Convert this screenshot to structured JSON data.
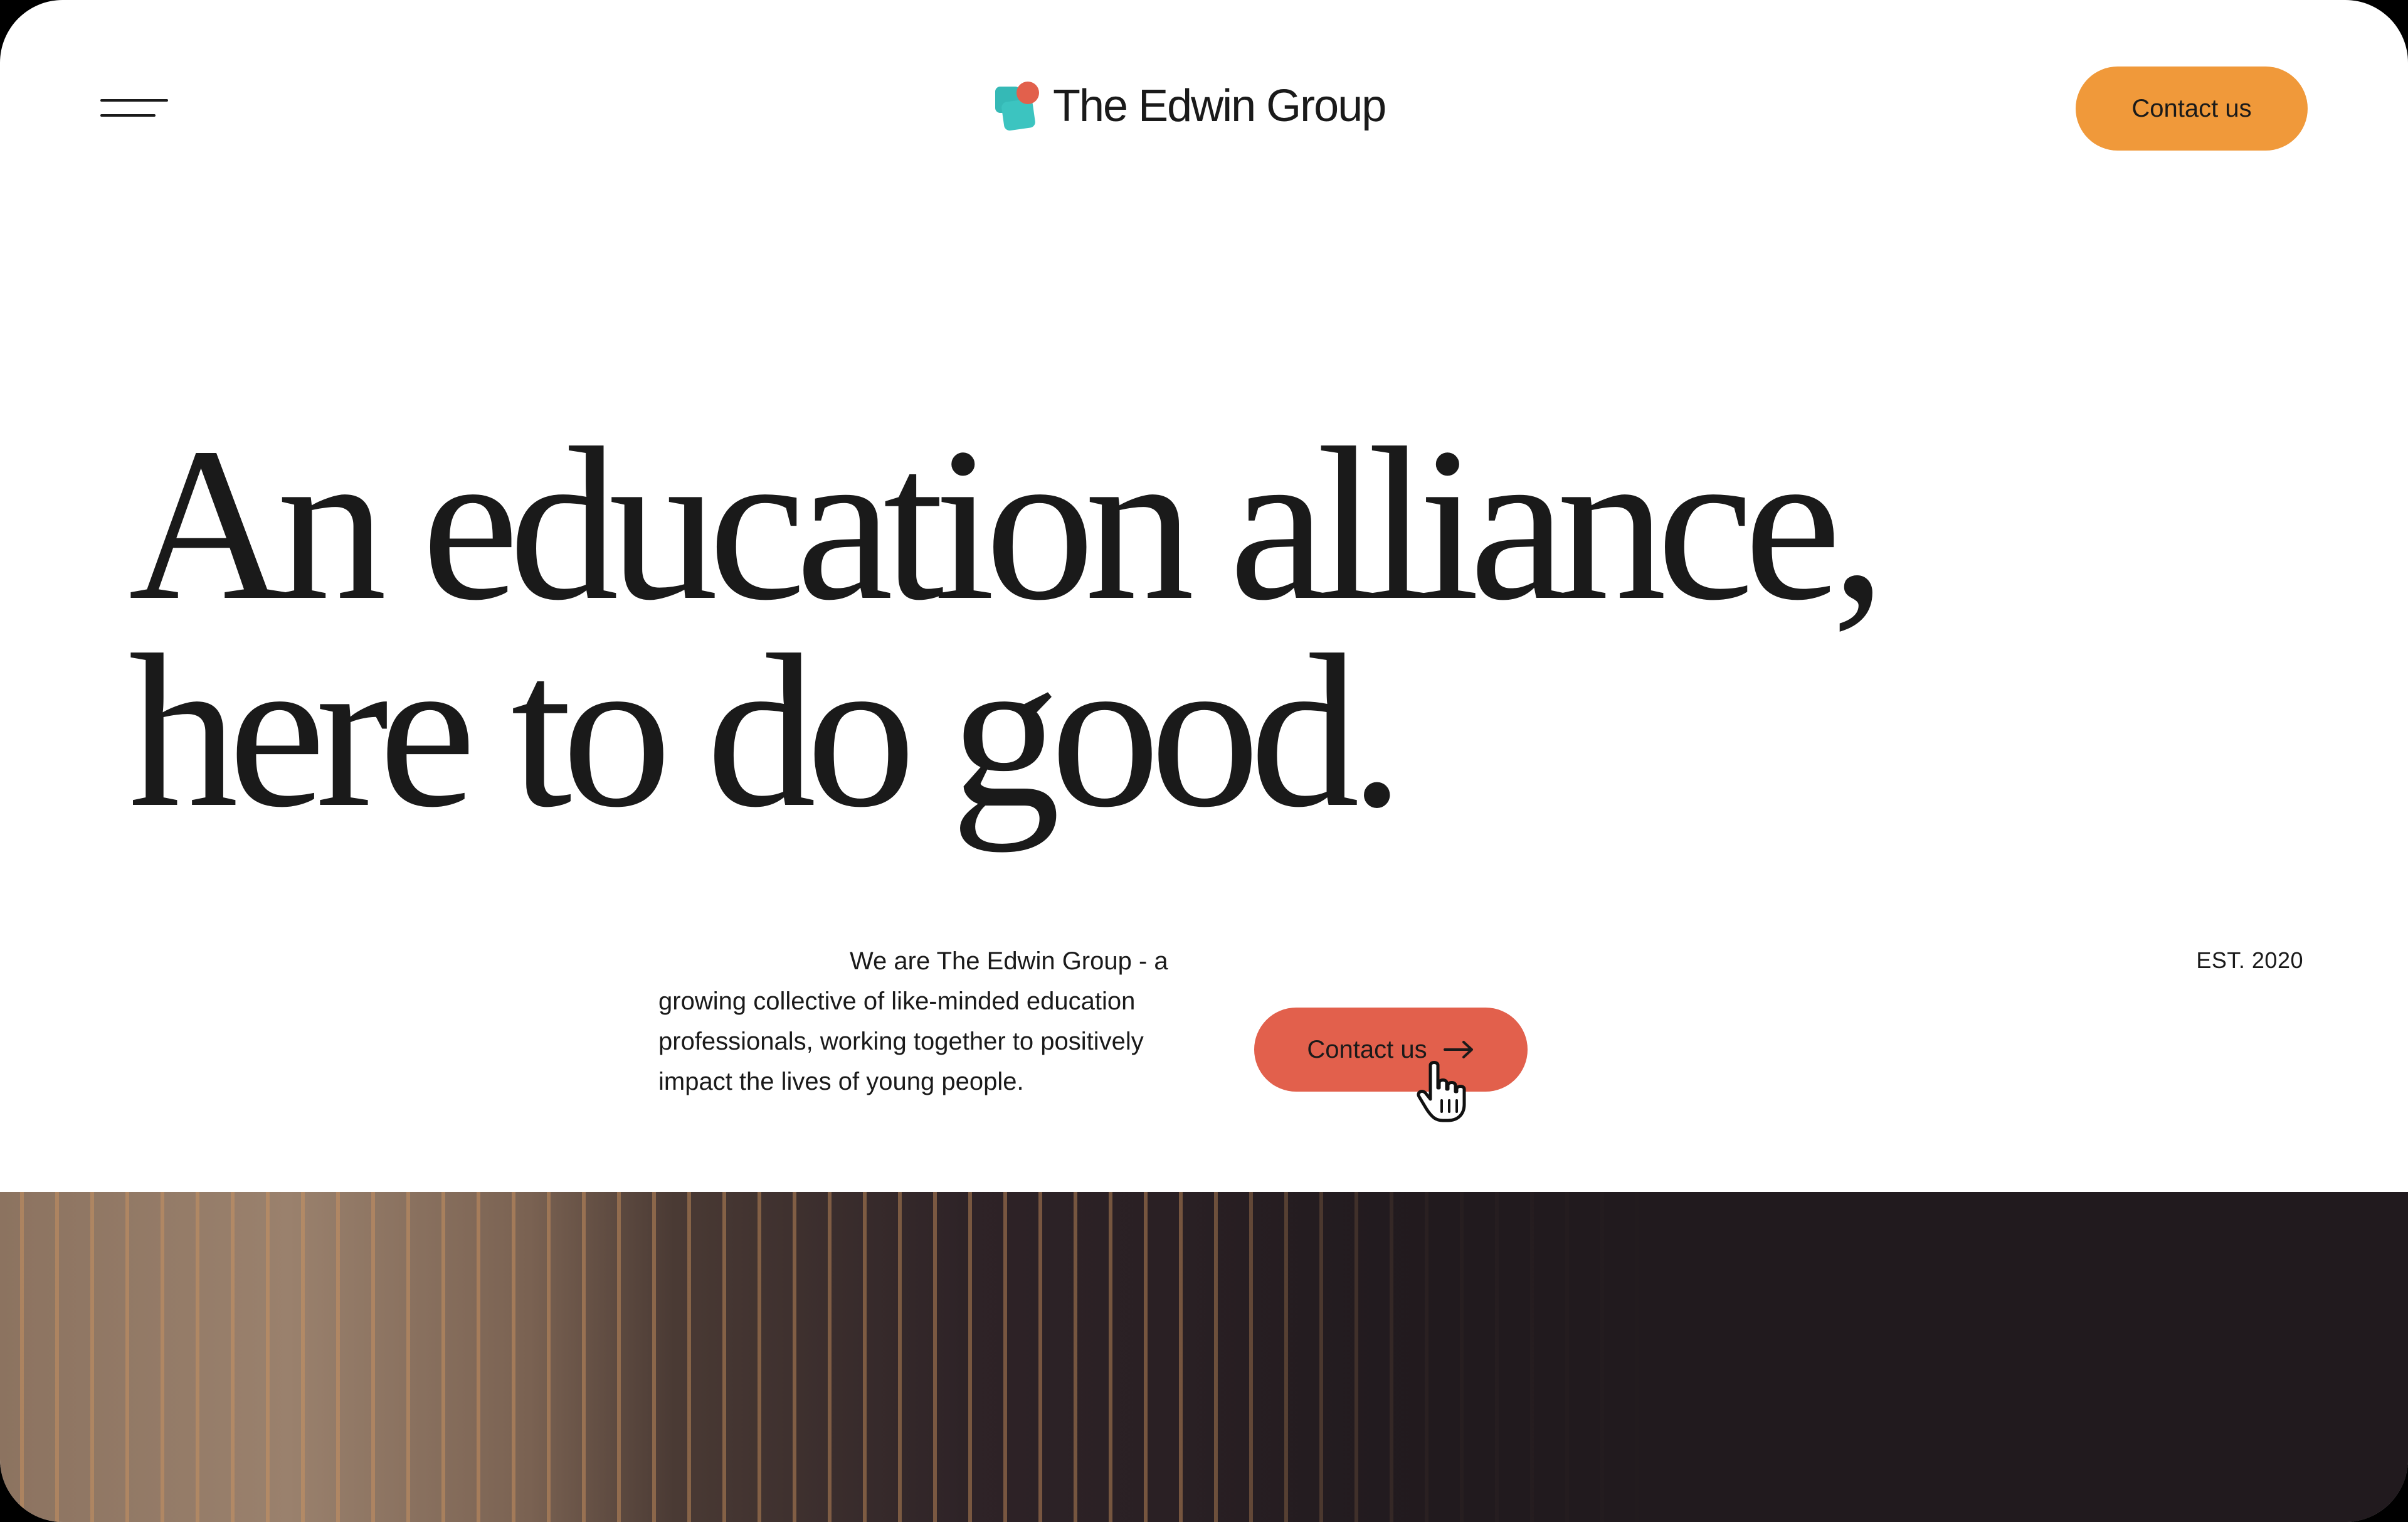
{
  "header": {
    "menu_icon": "menu-icon",
    "brand_name": "The Edwin Group",
    "logo_icon": "edwin-logo-mark",
    "cta_label": "Contact us"
  },
  "hero": {
    "headline_line1": "An education alliance,",
    "headline_line2": "here to do good.",
    "intro": "We are The Edwin Group - a growing collective of like-minded education professionals, working together to positively impact the lives of young people.",
    "established": "EST. 2020",
    "cta_label": "Contact us",
    "cta_icon": "arrow-right-icon"
  },
  "colors": {
    "accent_orange": "#f0993a",
    "accent_coral": "#e2604c",
    "brand_teal": "#35b9b6",
    "text": "#1a1a1a"
  }
}
